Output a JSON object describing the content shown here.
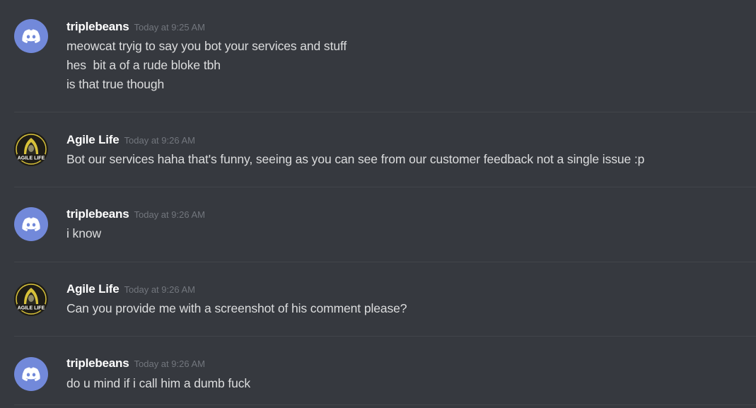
{
  "messages": [
    {
      "author": "triplebeans",
      "avatar_icon": "discord-logo-icon",
      "timestamp": "Today at 9:25 AM",
      "lines": [
        "meowcat tryig to say you bot your services and stuff",
        "hes  bit a of a rude bloke tbh",
        "is that true though"
      ]
    },
    {
      "author": "Agile Life",
      "avatar_icon": "agile-life-logo-icon",
      "avatar_text": "AGILE LIFE",
      "timestamp": "Today at 9:26 AM",
      "lines": [
        "Bot our services haha that's funny, seeing as you can see from our customer feedback not a single issue :p"
      ]
    },
    {
      "author": "triplebeans",
      "avatar_icon": "discord-logo-icon",
      "timestamp": "Today at 9:26 AM",
      "lines": [
        "i know"
      ]
    },
    {
      "author": "Agile Life",
      "avatar_icon": "agile-life-logo-icon",
      "avatar_text": "AGILE LIFE",
      "timestamp": "Today at 9:26 AM",
      "lines": [
        "Can you provide me with a screenshot of his comment please?"
      ]
    },
    {
      "author": "triplebeans",
      "avatar_icon": "discord-logo-icon",
      "timestamp": "Today at 9:26 AM",
      "lines": [
        "do u mind if i call him a dumb fuck"
      ]
    }
  ],
  "colors": {
    "background": "#36393f",
    "divider": "#42454a",
    "username": "#ffffff",
    "timestamp": "#72767d",
    "message_text": "#dcddde",
    "discord_avatar": "#7289da"
  }
}
